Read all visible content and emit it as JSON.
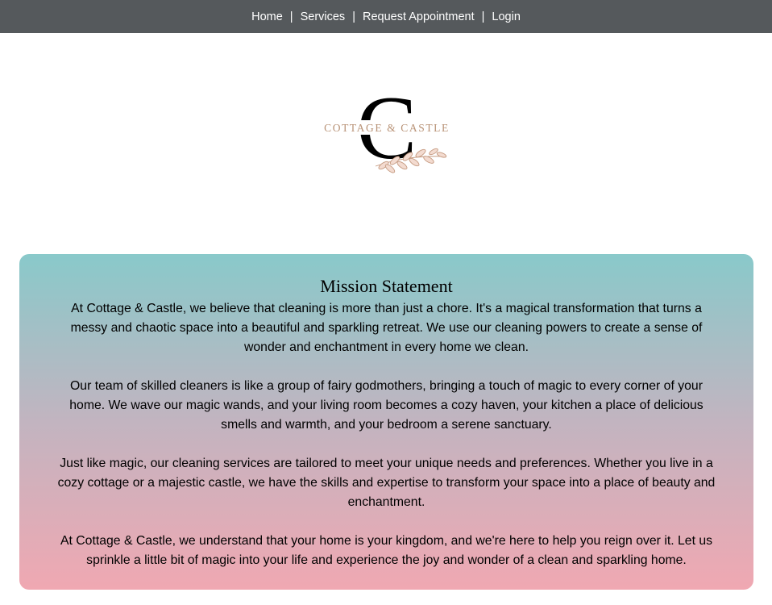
{
  "nav": {
    "items": [
      {
        "label": "Home"
      },
      {
        "label": "Services"
      },
      {
        "label": "Request Appointment"
      },
      {
        "label": "Login"
      }
    ],
    "separator": "|"
  },
  "logo": {
    "letter": "C",
    "wordmark": "COTTAGE & CASTLE",
    "letter_color": "#000000",
    "wordmark_color": "#b89276"
  },
  "mission": {
    "title": "Mission Statement",
    "paragraphs": [
      "At Cottage & Castle, we believe that cleaning is more than just a chore. It's a magical transformation that turns a messy and chaotic space into a beautiful and sparkling retreat. We use our cleaning powers to create a sense of wonder and enchantment in every home we clean.",
      "Our team of skilled cleaners is like a group of fairy godmothers, bringing a touch of magic to every corner of your home. We wave our magic wands, and your living room becomes a cozy haven, your kitchen a place of delicious smells and warmth, and your bedroom a serene sanctuary.",
      "Just like magic, our cleaning services are tailored to meet your unique needs and preferences. Whether you live in a cozy cottage or a majestic castle, we have the skills and expertise to transform your space into a place of beauty and enchantment.",
      "At Cottage & Castle, we understand that your home is your kingdom, and we're here to help you reign over it. Let us sprinkle a little bit of magic into your life and experience the joy and wonder of a clean and sparkling home."
    ],
    "gradient_colors": [
      "#89c9ca",
      "#c2b4c0",
      "#f0a8b2"
    ]
  },
  "colors": {
    "nav_background": "#55595c",
    "nav_text": "#ffffff"
  }
}
